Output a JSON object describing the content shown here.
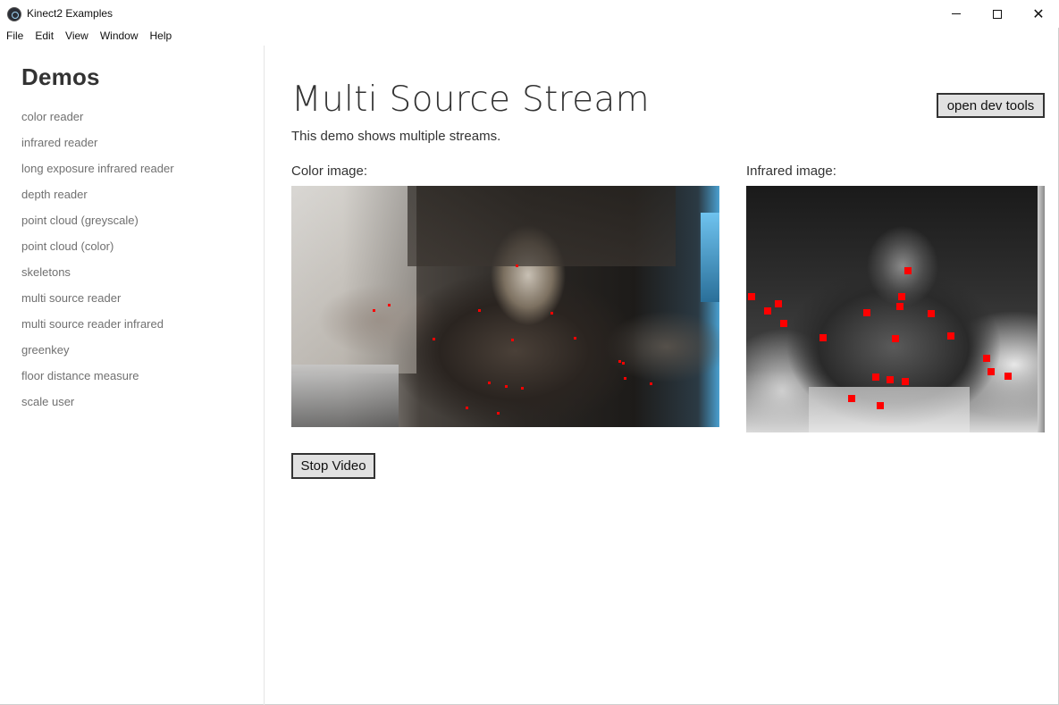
{
  "window": {
    "title": "Kinect2 Examples",
    "icon": "app-logo-icon",
    "controls": [
      "minimize",
      "maximize",
      "close"
    ]
  },
  "menubar": {
    "items": [
      "File",
      "Edit",
      "View",
      "Window",
      "Help"
    ]
  },
  "sidebar": {
    "title": "Demos",
    "items": [
      "color reader",
      "infrared reader",
      "long exposure infrared reader",
      "depth reader",
      "point cloud (greyscale)",
      "point cloud (color)",
      "skeletons",
      "multi source reader",
      "multi source reader infrared",
      "greenkey",
      "floor distance measure",
      "scale user"
    ]
  },
  "main": {
    "title": "Multi Source Stream",
    "description": "This demo shows multiple streams.",
    "devtools_label": "open dev tools",
    "color_label": "Color image:",
    "infrared_label": "Infrared image:",
    "stop_label": "Stop Video"
  },
  "colors": {
    "joint_marker": "#ff0000",
    "button_bg": "#e1e1e1",
    "nav_text": "#707070"
  }
}
